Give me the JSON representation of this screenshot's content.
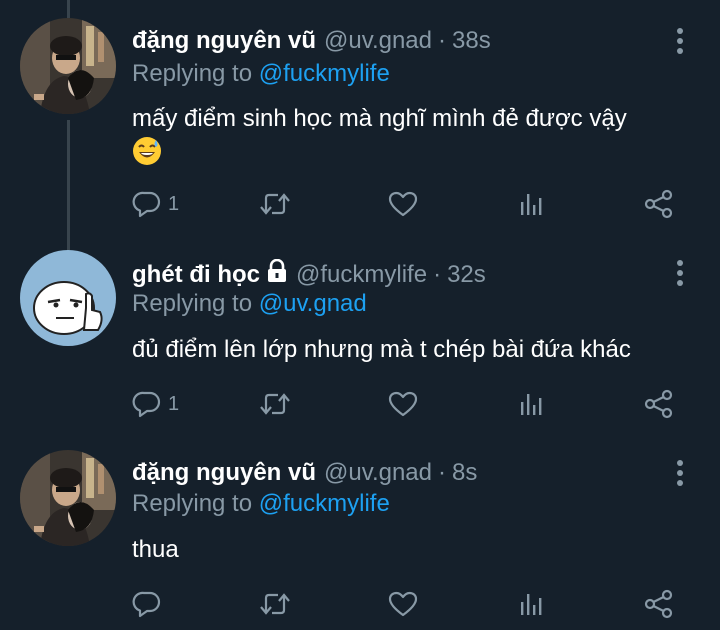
{
  "tweets": [
    {
      "name": "đặng nguyên vũ",
      "handle": "@uv.gnad",
      "separator": "·",
      "time": "38s",
      "replying_prefix": "Replying to",
      "replying_to": "@fuckmylife",
      "text": "mấy điểm sinh học mà nghĩ mình đẻ được vậy",
      "emoji": "😅",
      "reply_count": "1",
      "locked": false
    },
    {
      "name": "ghét đi học",
      "handle": "@fuckmylife",
      "separator": "·",
      "time": "32s",
      "replying_prefix": "Replying to",
      "replying_to": "@uv.gnad",
      "text": "đủ điểm lên lớp nhưng mà t chép bài đứa khác",
      "reply_count": "1",
      "locked": true
    },
    {
      "name": "đặng nguyên vũ",
      "handle": "@uv.gnad",
      "separator": "·",
      "time": "8s",
      "replying_prefix": "Replying to",
      "replying_to": "@fuckmylife",
      "text": "thua",
      "reply_count": "",
      "locked": false
    }
  ],
  "icons": [
    "reply-icon",
    "retweet-icon",
    "like-icon",
    "analytics-icon",
    "share-icon",
    "more-icon",
    "lock-icon"
  ],
  "colors": {
    "background": "#15202b",
    "secondary_text": "#8899a6",
    "accent": "#1da1f2",
    "thread_line": "#38444d"
  }
}
